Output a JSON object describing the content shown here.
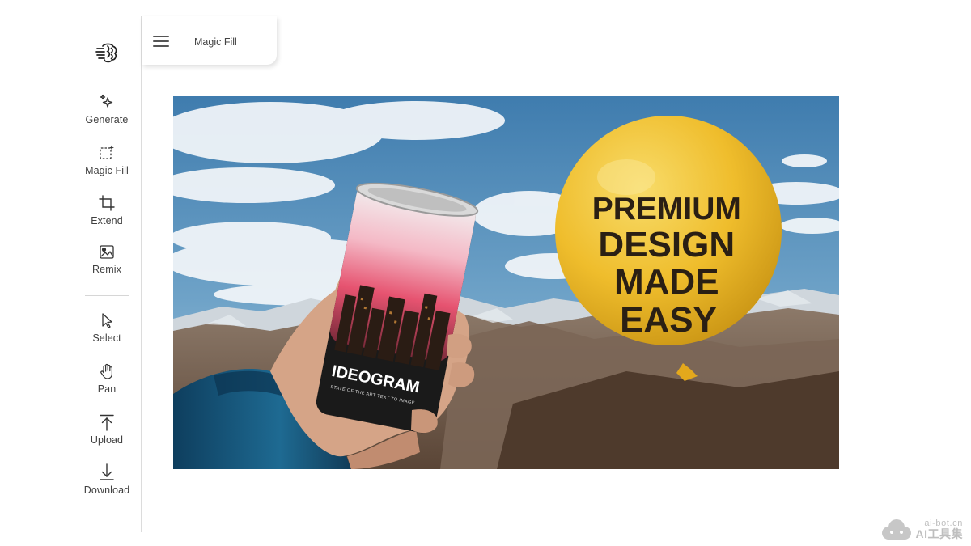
{
  "header": {
    "title": "Magic Fill",
    "menu_icon": "hamburger-menu-icon"
  },
  "sidebar": {
    "logo_icon": "ideogram-brain-logo-icon",
    "tools": [
      {
        "label": "Generate",
        "icon": "sparkles-icon"
      },
      {
        "label": "Magic Fill",
        "icon": "magic-selection-icon"
      },
      {
        "label": "Extend",
        "icon": "crop-extend-icon"
      },
      {
        "label": "Remix",
        "icon": "image-remix-icon"
      },
      {
        "label": "Select",
        "icon": "cursor-arrow-icon"
      },
      {
        "label": "Pan",
        "icon": "hand-icon"
      },
      {
        "label": "Upload",
        "icon": "upload-arrow-icon"
      },
      {
        "label": "Download",
        "icon": "download-arrow-icon"
      }
    ]
  },
  "canvas": {
    "can_label": "IDEOGRAM",
    "can_tagline": "STATE OF THE ART TEXT TO IMAGE",
    "balloon_lines": [
      "PREMIUM",
      "DESIGN",
      "MADE",
      "EASY"
    ]
  },
  "watermark": {
    "line1": "ai-bot.cn",
    "line2": "AI工具集"
  },
  "colors": {
    "sidebar_border": "#dcdcdc",
    "balloon": "#f2c230",
    "balloon_text": "#2a1f14",
    "sky": "#4e88b8"
  }
}
